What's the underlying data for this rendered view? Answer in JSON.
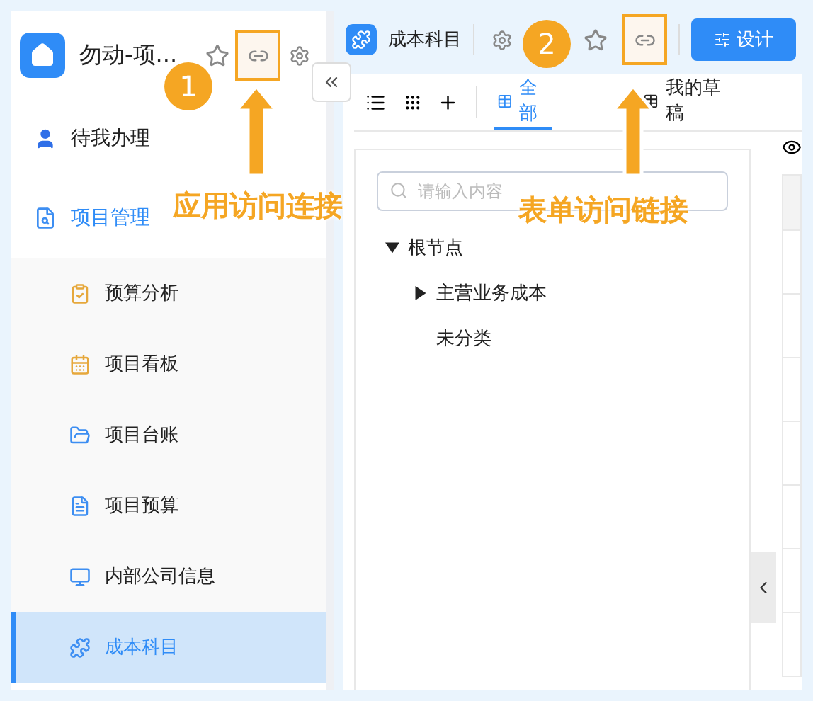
{
  "sidebar": {
    "app_title": "勿动-项...",
    "nav": [
      {
        "label": "待我办理",
        "expanded": false
      },
      {
        "label": "项目管理",
        "expanded": true,
        "children": [
          {
            "label": "预算分析",
            "selected": false
          },
          {
            "label": "项目看板",
            "selected": false
          },
          {
            "label": "项目台账",
            "selected": false
          },
          {
            "label": "项目预算",
            "selected": false
          },
          {
            "label": "内部公司信息",
            "selected": false
          },
          {
            "label": "成本科目",
            "selected": true
          }
        ]
      }
    ]
  },
  "form_header": {
    "title": "成本科目",
    "design_button": "设计"
  },
  "toolbar": {
    "tabs": [
      {
        "label": "全部",
        "selected": true
      },
      {
        "label": "我的草稿",
        "selected": false
      }
    ]
  },
  "tree": {
    "search": {
      "placeholder": "请输入内容"
    },
    "nodes": [
      {
        "label": "根节点",
        "kind": "branch",
        "expanded": true,
        "children": [
          {
            "label": "主营业务成本",
            "kind": "branch",
            "expanded": false
          },
          {
            "label": "未分类",
            "kind": "leaf"
          }
        ]
      }
    ]
  },
  "annotations": [
    {
      "number": "1",
      "label": "应用访问连接"
    },
    {
      "number": "2",
      "label": "表单访问链接"
    }
  ]
}
